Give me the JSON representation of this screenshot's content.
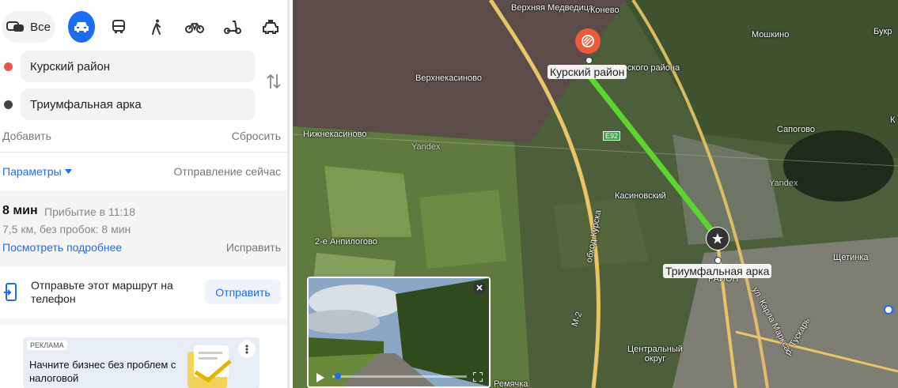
{
  "modes": {
    "all_label": "Все",
    "items": [
      "car-icon",
      "bus-icon",
      "walk-icon",
      "bike-icon",
      "scooter-icon",
      "taxi-icon"
    ],
    "active": "car"
  },
  "route": {
    "from": "Курский район",
    "to": "Триумфальная арка",
    "add_label": "Добавить",
    "reset_label": "Сбросить"
  },
  "params": {
    "label": "Параметры",
    "departure": "Отправление сейчас"
  },
  "result": {
    "duration": "8 мин",
    "arrival": "Прибытие в 11:18",
    "details": "7,5 км, без пробок: 8 мин",
    "more_link": "Посмотреть подробнее",
    "fix_link": "Исправить"
  },
  "send": {
    "text": "Отправьте этот маршрут на телефон",
    "button": "Отправить"
  },
  "ad": {
    "badge": "РЕКЛАМА",
    "text": "Начните бизнес без проблем с налоговой"
  },
  "map": {
    "places": [
      "Верхняя Медведица",
      "Конево",
      "Мошкино",
      "Букр",
      "Верхнекасиново",
      "Нижнекасиново",
      "Сапогово",
      "Касиновский",
      "2-е Анпилогово",
      "Щетинка",
      "Центральный округ",
      "Ремячка",
      "Курского района",
      "ул. Карла Маркса",
      "р. Тускарь",
      "Yandex",
      "Yandex"
    ],
    "origin_label": "Курский район",
    "dest_label": "Триумфальная арка",
    "route_badge": "E92",
    "road_m2": "М-2",
    "bypass": "обход Курска",
    "dest_under": "РАЙОН",
    "letter_k": "К"
  },
  "colors": {
    "accent": "#1a6df4",
    "route": "#5ed42f",
    "origin": "#ef5350",
    "pin": "#ee5a3a"
  }
}
